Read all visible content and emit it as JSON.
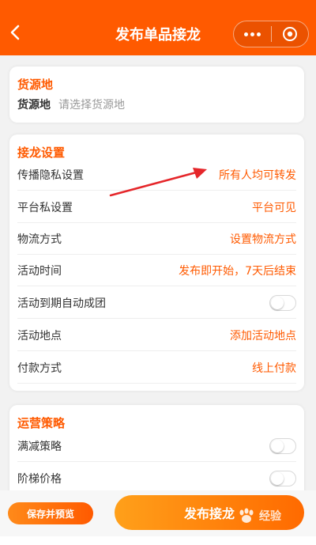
{
  "header": {
    "title": "发布单品接龙"
  },
  "source_card": {
    "title": "货源地",
    "label": "货源地",
    "placeholder": "请选择货源地"
  },
  "settings_card": {
    "title": "接龙设置",
    "rows": [
      {
        "label": "传播隐私设置",
        "value": "所有人均可转发"
      },
      {
        "label": "平台私设置",
        "value": "平台可见"
      },
      {
        "label": "物流方式",
        "value": "设置物流方式"
      },
      {
        "label": "活动时间",
        "value": "发布即开始，7天后结束"
      },
      {
        "label": "活动到期自动成团",
        "toggle": false
      },
      {
        "label": "活动地点",
        "value": "添加活动地点"
      },
      {
        "label": "付款方式",
        "value": "线上付款"
      }
    ]
  },
  "strategy_card": {
    "title": "运营策略",
    "rows": [
      {
        "label": "满减策略",
        "toggle": false
      },
      {
        "label": "阶梯价格",
        "toggle": false
      }
    ]
  },
  "footer": {
    "save_label": "保存并预览",
    "publish_label": "发布接龙"
  },
  "watermark": {
    "text": "经验"
  },
  "colors": {
    "accent": "#ff5a00",
    "background": "#f2f2f2"
  },
  "annotation": {
    "arrow_color": "#e5262a"
  }
}
